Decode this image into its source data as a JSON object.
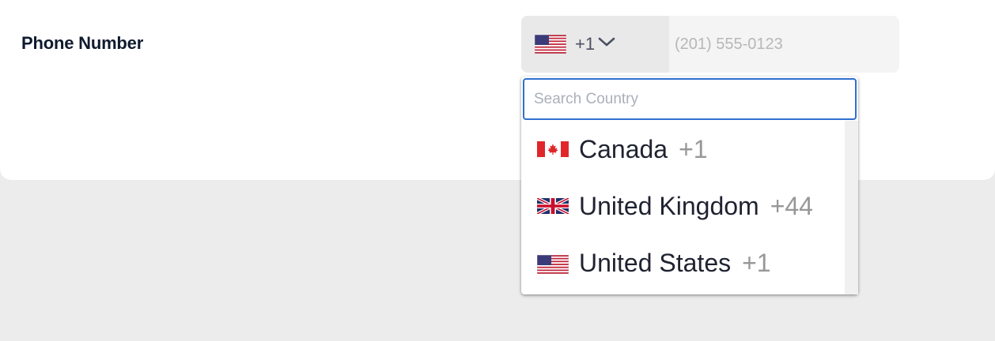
{
  "form": {
    "label": "Phone Number",
    "selected_country": {
      "flag_icon": "us-flag-icon",
      "dial_code": "+1"
    },
    "phone_placeholder": "(201) 555-0123",
    "chevron_icon": "chevron-down-icon"
  },
  "dropdown": {
    "search_placeholder": "Search Country",
    "options": [
      {
        "name": "Canada",
        "code": "+1",
        "flag_icon": "canada-flag-icon"
      },
      {
        "name": "United Kingdom",
        "code": "+44",
        "flag_icon": "uk-flag-icon"
      },
      {
        "name": "United States",
        "code": "+1",
        "flag_icon": "us-flag-icon"
      }
    ]
  },
  "colors": {
    "accent": "#2f6fce",
    "label": "#0f1a2e",
    "page_background": "#ececec"
  }
}
